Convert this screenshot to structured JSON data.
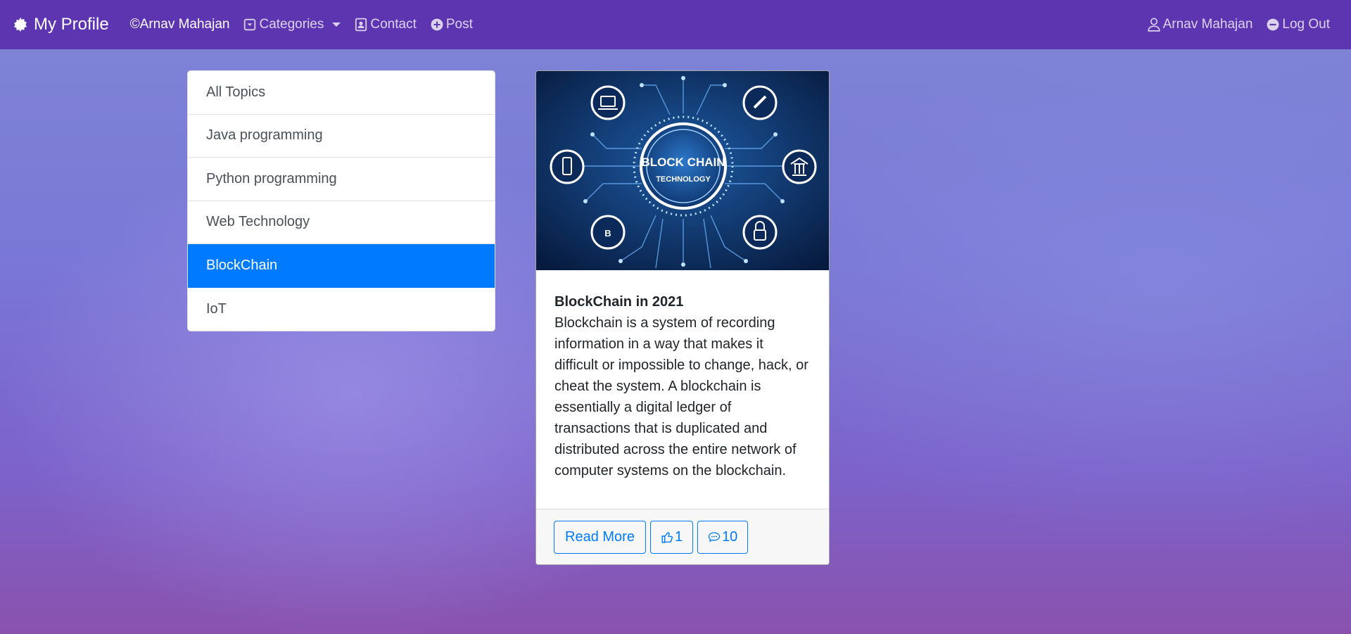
{
  "navbar": {
    "brand": "My Profile",
    "brand_icon": "gear-icon",
    "items": [
      {
        "label": "©Arnav Mahajan",
        "icon": "copyright-icon"
      },
      {
        "label": "Categories",
        "icon": "dropdown-box-icon"
      },
      {
        "label": "Contact",
        "icon": "contact-card-icon"
      },
      {
        "label": "Post",
        "icon": "plus-circle-icon"
      }
    ],
    "right": [
      {
        "label": "Arnav Mahajan",
        "icon": "user-icon"
      },
      {
        "label": "Log Out",
        "icon": "minus-circle-icon"
      }
    ]
  },
  "categories": [
    {
      "label": "All Topics",
      "active": false
    },
    {
      "label": "Java programming",
      "active": false
    },
    {
      "label": "Python programming",
      "active": false
    },
    {
      "label": "Web Technology",
      "active": false
    },
    {
      "label": "BlockChain",
      "active": true
    },
    {
      "label": "IoT",
      "active": false
    }
  ],
  "post": {
    "image_text_line1": "BLOCK CHAIN",
    "image_text_line2": "TECHNOLOGY",
    "title": "BlockChain in 2021",
    "content": "Blockchain is a system of recording information in a way that makes it difficult or impossible to change, hack, or cheat the system. A blockchain is essentially a digital ledger of transactions that is duplicated and distributed across the entire network of computer systems on the blockchain.",
    "read_more": "Read More",
    "likes": "1",
    "comments": "10"
  },
  "colors": {
    "navbar": "#5d35b1",
    "active_item": "#007bff",
    "button_outline": "#007bff"
  }
}
